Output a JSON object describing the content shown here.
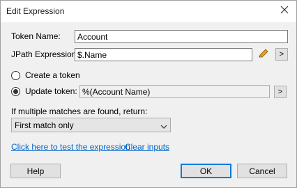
{
  "window": {
    "title": "Edit Expression"
  },
  "fields": {
    "token_name_label": "Token Name:",
    "token_name_value": "Account",
    "jpath_label": "JPath Expression:",
    "jpath_value": "$.Name",
    "jpath_more": ">",
    "create_token_label": "Create a token",
    "update_token_label": "Update token:",
    "update_token_value": "%(Account Name)",
    "update_token_more": ">"
  },
  "matches": {
    "label": "If multiple matches are found, return:",
    "selected": "First match only"
  },
  "links": {
    "test": "Click here to test the expression",
    "clear": "Clear inputs"
  },
  "buttons": {
    "help": "Help",
    "ok": "OK",
    "cancel": "Cancel"
  },
  "radio_selected": "update_token",
  "colors": {
    "accent": "#0078d7",
    "link": "#0066cc",
    "pencil": "#e8a317"
  },
  "icons": {
    "close": "close-icon",
    "edit": "pencil-icon",
    "dropdown": "chevron-down-icon"
  }
}
